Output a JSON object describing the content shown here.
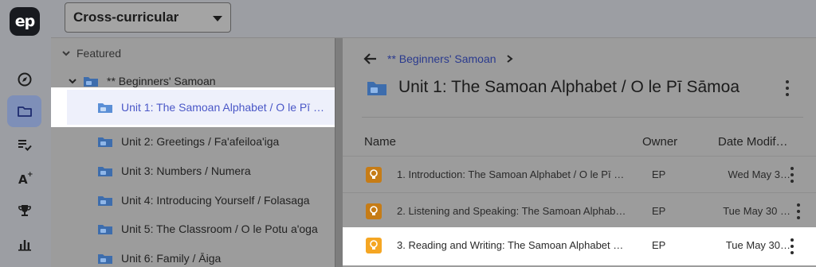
{
  "app": {
    "logo_text": "ep",
    "accent_color": "#4a57c7",
    "rail": [
      {
        "icon": "compass-icon",
        "active": false
      },
      {
        "icon": "folder-icon",
        "active": true
      },
      {
        "icon": "checklist-icon",
        "active": false
      },
      {
        "icon": "grade-icon",
        "active": false
      },
      {
        "icon": "trophy-icon",
        "active": false
      },
      {
        "icon": "bar-chart-icon",
        "active": false
      }
    ]
  },
  "topbar": {
    "dropdown_value": "Cross-curricular"
  },
  "tree": {
    "featured_label": "Featured",
    "course_label": "** Beginners' Samoan",
    "units": [
      "Unit 1: The Samoan Alphabet / O le Pī Sāmoa",
      "Unit 2: Greetings / Fa'afeiloa'iga",
      "Unit 3: Numbers / Numera",
      "Unit 4: Introducing Yourself / Folasaga",
      "Unit 5: The Classroom / O le Potu a'oga",
      "Unit 6: Family / Āiga"
    ],
    "selected_display": "Unit 1: The Samoan Alphabet / O le Pī …"
  },
  "main": {
    "breadcrumb": "** Beginners' Samoan",
    "title": "Unit 1: The Samoan Alphabet / O le Pī Sāmoa",
    "columns": {
      "name": "Name",
      "owner": "Owner",
      "date": "Date Modif…"
    },
    "rows": [
      {
        "name": "1. Introduction: The Samoan Alphabet / O le Pī …",
        "owner": "EP",
        "date": "Wed May 3…"
      },
      {
        "name": "2. Listening and Speaking: The Samoan Alphab…",
        "owner": "EP",
        "date": "Tue May 30 …"
      },
      {
        "name": "3. Reading and Writing: The Samoan Alphabet …",
        "owner": "EP",
        "date": "Tue May 30…"
      }
    ]
  }
}
